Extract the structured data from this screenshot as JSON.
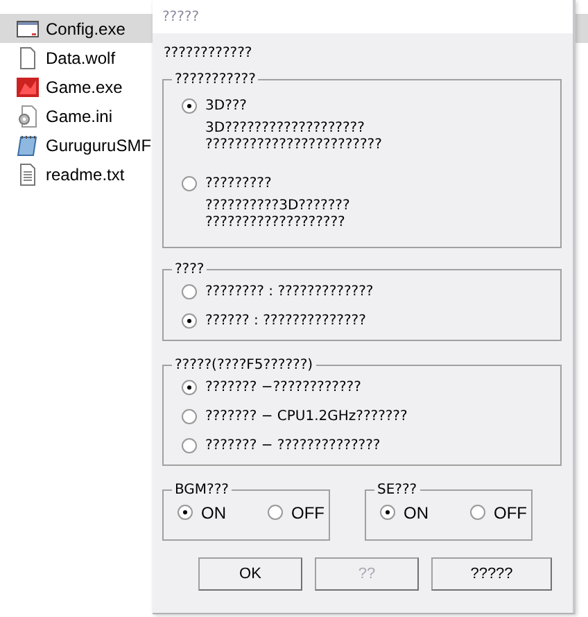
{
  "explorer": {
    "files": [
      {
        "name": "Config.exe",
        "kind": "window",
        "selected": true
      },
      {
        "name": "Data.wolf",
        "kind": "blank",
        "selected": false
      },
      {
        "name": "Game.exe",
        "kind": "game",
        "selected": false
      },
      {
        "name": "Game.ini",
        "kind": "settings",
        "selected": false
      },
      {
        "name": "GuruguruSMF",
        "kind": "notepad",
        "selected": false
      },
      {
        "name": "readme.txt",
        "kind": "text",
        "selected": false
      }
    ]
  },
  "dialog": {
    "title": "?????",
    "intro": "????????????",
    "groups": [
      {
        "kind": "described",
        "title": "???????????",
        "options": [
          {
            "label": "3D???",
            "selected": true,
            "description": [
              "3D???????????????????",
              "????????????????????????"
            ]
          },
          {
            "label": "?????????",
            "selected": false,
            "description": [
              "??????????3D???????",
              "???????????????????"
            ]
          }
        ]
      },
      {
        "kind": "stacked",
        "title": "????",
        "options": [
          {
            "label": "???????? : ?????????????",
            "selected": false
          },
          {
            "label": "?????? : ??????????????",
            "selected": true
          }
        ]
      },
      {
        "kind": "stacked",
        "title": "?????(????F5??????)",
        "options": [
          {
            "label": "??????? −????????????",
            "selected": true
          },
          {
            "label": "??????? −   CPU1.2GHz???????",
            "selected": false
          },
          {
            "label": "??????? −   ??????????????",
            "selected": false
          }
        ]
      }
    ],
    "toggles": [
      {
        "title": "BGM???",
        "options": [
          {
            "label": "ON",
            "selected": true
          },
          {
            "label": "OFF",
            "selected": false
          }
        ]
      },
      {
        "title": "SE???",
        "options": [
          {
            "label": "ON",
            "selected": true
          },
          {
            "label": "OFF",
            "selected": false
          }
        ]
      }
    ],
    "buttons": [
      {
        "label": "OK",
        "disabled": false
      },
      {
        "label": "??",
        "disabled": true
      },
      {
        "label": "?????",
        "disabled": false
      }
    ]
  }
}
